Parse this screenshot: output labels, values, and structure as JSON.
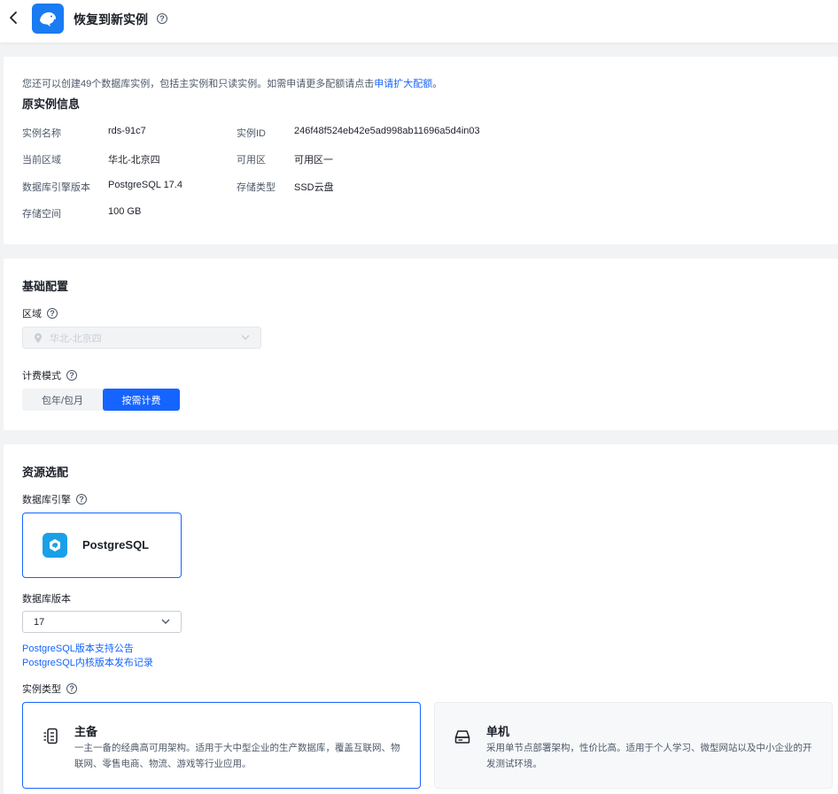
{
  "header": {
    "title": "恢复到新实例"
  },
  "quota": {
    "text": "您还可以创建49个数据库实例，包括主实例和只读实例。如需申请更多配额请点击",
    "link": "申请扩大配额",
    "suffix": "。"
  },
  "original": {
    "title": "原实例信息",
    "fields": [
      {
        "label": "实例名称",
        "value": "rds-91c7"
      },
      {
        "label": "实例ID",
        "value": "246f48f524eb42e5ad998ab11696a5d4in03"
      },
      {
        "label": "当前区域",
        "value": "华北-北京四"
      },
      {
        "label": "可用区",
        "value": "可用区一"
      },
      {
        "label": "数据库引擎版本",
        "value": "PostgreSQL 17.4"
      },
      {
        "label": "存储类型",
        "value": "SSD云盘"
      },
      {
        "label": "存储空间",
        "value": "100 GB"
      }
    ]
  },
  "basic": {
    "title": "基础配置",
    "region_label": "区域",
    "region_value": "华北-北京四",
    "billing_label": "计费模式",
    "billing_options": [
      "包年/包月",
      "按需计费"
    ],
    "billing_selected": "按需计费"
  },
  "resource": {
    "title": "资源选配",
    "engine_label": "数据库引擎",
    "engine_name": "PostgreSQL",
    "version_label": "数据库版本",
    "version_value": "17",
    "links": [
      "PostgreSQL版本支持公告",
      "PostgreSQL内核版本发布记录"
    ],
    "type_label": "实例类型",
    "types": [
      {
        "name": "主备",
        "desc": "一主一备的经典高可用架构。适用于大中型企业的生产数据库，覆盖互联网、物联网、零售电商、物流、游戏等行业应用。"
      },
      {
        "name": "单机",
        "desc": "采用单节点部署架构，性价比高。适用于个人学习、微型网站以及中小企业的开发测试环境。"
      }
    ]
  },
  "colors": {
    "primary": "#1664ff",
    "logo": "#1a7bf2"
  }
}
